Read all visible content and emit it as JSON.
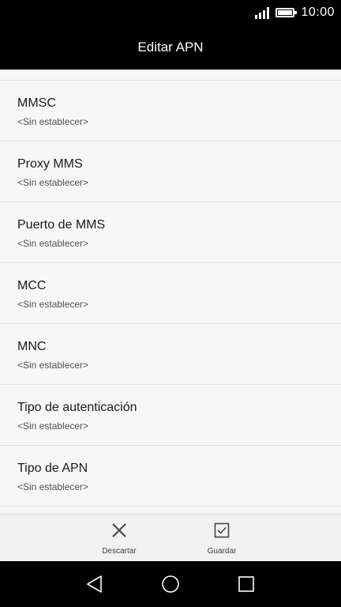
{
  "status_bar": {
    "time": "10:00"
  },
  "header": {
    "title": "Editar APN"
  },
  "settings": {
    "items": [
      {
        "title": "MMSC",
        "value": "<Sin establecer>"
      },
      {
        "title": "Proxy MMS",
        "value": "<Sin establecer>"
      },
      {
        "title": "Puerto de MMS",
        "value": "<Sin establecer>"
      },
      {
        "title": "MCC",
        "value": "<Sin establecer>"
      },
      {
        "title": "MNC",
        "value": "<Sin establecer>"
      },
      {
        "title": "Tipo de autenticación",
        "value": "<Sin establecer>"
      },
      {
        "title": "Tipo de APN",
        "value": "<Sin establecer>"
      }
    ]
  },
  "actions": {
    "discard_label": "Descartar",
    "save_label": "Guardar"
  },
  "icons": {
    "discard": "close-icon",
    "save": "checkbox-icon",
    "nav_back": "back-triangle-icon",
    "nav_home": "home-circle-icon",
    "nav_recents": "recents-square-icon"
  }
}
